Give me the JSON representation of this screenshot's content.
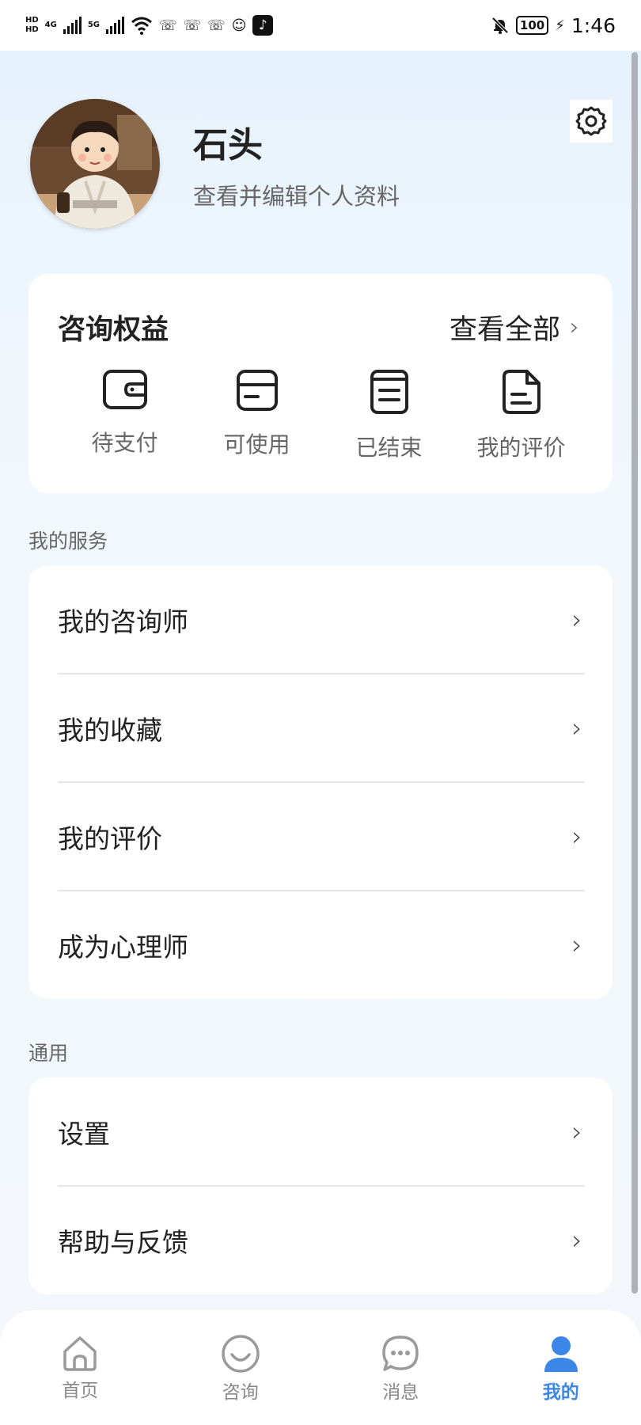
{
  "status_bar": {
    "left_tags": [
      "HD",
      "HD"
    ],
    "net_4g": "4G",
    "net_5g": "5G",
    "icons": [
      "wifi-icon",
      "missed-call-icon",
      "missed-call-icon",
      "missed-call-icon",
      "robot-icon",
      "tiktok-icon"
    ],
    "battery": "100",
    "time": "1:46"
  },
  "profile": {
    "name": "石头",
    "edit_text": "查看并编辑个人资料",
    "settings_icon": "gear-icon"
  },
  "rights": {
    "title": "咨询权益",
    "view_all": "查看全部",
    "items": [
      {
        "label": "待支付",
        "icon": "wallet-icon"
      },
      {
        "label": "可使用",
        "icon": "box-icon"
      },
      {
        "label": "已结束",
        "icon": "clipboard-icon"
      },
      {
        "label": "我的评价",
        "icon": "document-icon"
      }
    ]
  },
  "services": {
    "label": "我的服务",
    "items": [
      "我的咨询师",
      "我的收藏",
      "我的评价",
      "成为心理师"
    ]
  },
  "general": {
    "label": "通用",
    "items": [
      "设置",
      "帮助与反馈"
    ]
  },
  "tabbar": {
    "active_color": "#3b86e6",
    "items": [
      {
        "label": "首页",
        "icon": "home-icon"
      },
      {
        "label": "咨询",
        "icon": "smile-icon"
      },
      {
        "label": "消息",
        "icon": "chat-icon"
      },
      {
        "label": "我的",
        "icon": "user-icon"
      }
    ]
  }
}
